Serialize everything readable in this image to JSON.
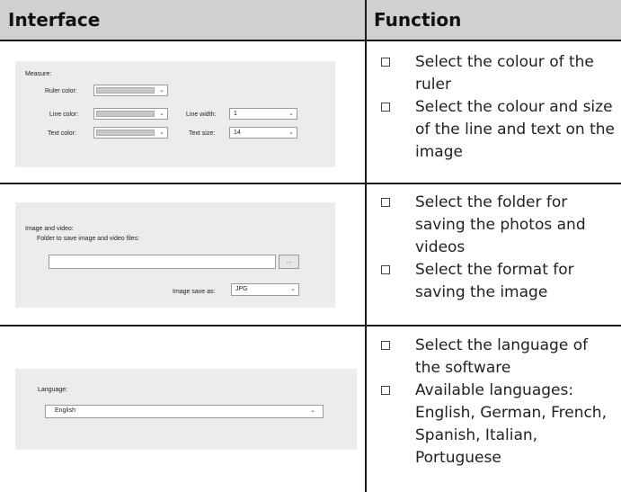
{
  "header": {
    "interface": "Interface",
    "function": "Function"
  },
  "rows": [
    {
      "panel": {
        "section": "Measure:",
        "ruler_color": "Ruler color:",
        "line_color": "Line color:",
        "text_color": "Text color:",
        "line_width_label": "Line width:",
        "line_width_value": "1",
        "text_size_label": "Text size:",
        "text_size_value": "14"
      },
      "functions": [
        "Select the colour of the ruler",
        "Select the colour and size of the line and text on the image"
      ]
    },
    {
      "panel": {
        "section": "Image and video:",
        "folder_label": "Folder to save image and video files:",
        "browse": "...",
        "save_as_label": "Image save as:",
        "save_as_value": "JPG"
      },
      "functions": [
        "Select the folder for saving the photos and videos",
        "Select the format for saving the image"
      ]
    },
    {
      "panel": {
        "section": "Language:",
        "language_value": "English"
      },
      "functions": [
        "Select the language of the software",
        "Available languages: English, German, French, Spanish, Italian, Portuguese"
      ]
    }
  ]
}
